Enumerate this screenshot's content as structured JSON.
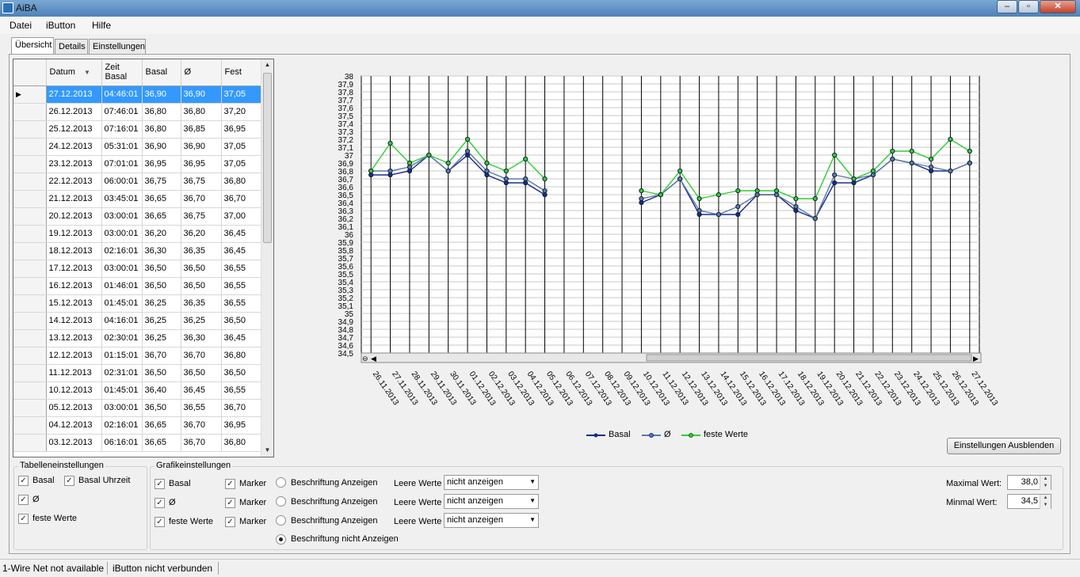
{
  "window": {
    "title": "AiBA"
  },
  "menu": [
    "Datei",
    "iButton",
    "Hilfe"
  ],
  "tabs": [
    "Übersicht",
    "Details",
    "Einstellungen"
  ],
  "table": {
    "columns": [
      "Datum",
      "Zeit Basal",
      "Basal",
      "Ø",
      "Fest"
    ],
    "rows": [
      [
        "27.12.2013",
        "04:46:01",
        "36,90",
        "36,90",
        "37,05"
      ],
      [
        "26.12.2013",
        "07:46:01",
        "36,80",
        "36,80",
        "37,20"
      ],
      [
        "25.12.2013",
        "07:16:01",
        "36,80",
        "36,85",
        "36,95"
      ],
      [
        "24.12.2013",
        "05:31:01",
        "36,90",
        "36,90",
        "37,05"
      ],
      [
        "23.12.2013",
        "07:01:01",
        "36,95",
        "36,95",
        "37,05"
      ],
      [
        "22.12.2013",
        "06:00:01",
        "36,75",
        "36,75",
        "36,80"
      ],
      [
        "21.12.2013",
        "03:45:01",
        "36,65",
        "36,70",
        "36,70"
      ],
      [
        "20.12.2013",
        "03:00:01",
        "36,65",
        "36,75",
        "37,00"
      ],
      [
        "19.12.2013",
        "03:00:01",
        "36,20",
        "36,20",
        "36,45"
      ],
      [
        "18.12.2013",
        "02:16:01",
        "36,30",
        "36,35",
        "36,45"
      ],
      [
        "17.12.2013",
        "03:00:01",
        "36,50",
        "36,50",
        "36,55"
      ],
      [
        "16.12.2013",
        "01:46:01",
        "36,50",
        "36,50",
        "36,55"
      ],
      [
        "15.12.2013",
        "01:45:01",
        "36,25",
        "36,35",
        "36,55"
      ],
      [
        "14.12.2013",
        "04:16:01",
        "36,25",
        "36,25",
        "36,50"
      ],
      [
        "13.12.2013",
        "02:30:01",
        "36,25",
        "36,30",
        "36,45"
      ],
      [
        "12.12.2013",
        "01:15:01",
        "36,70",
        "36,70",
        "36,80"
      ],
      [
        "11.12.2013",
        "02:31:01",
        "36,50",
        "36,50",
        "36,50"
      ],
      [
        "10.12.2013",
        "01:45:01",
        "36,40",
        "36,45",
        "36,55"
      ],
      [
        "05.12.2013",
        "03:00:01",
        "36,50",
        "36,55",
        "36,70"
      ],
      [
        "04.12.2013",
        "02:16:01",
        "36,65",
        "36,70",
        "36,95"
      ],
      [
        "03.12.2013",
        "06:16:01",
        "36,65",
        "36,70",
        "36,80"
      ]
    ]
  },
  "chart_data": {
    "type": "line",
    "ylim": [
      34.5,
      38
    ],
    "yticks": [
      "34,5",
      "34,6",
      "34,7",
      "34,8",
      "34,9",
      "35",
      "35,1",
      "35,2",
      "35,3",
      "35,4",
      "35,5",
      "35,6",
      "35,7",
      "35,8",
      "35,9",
      "36",
      "36,1",
      "36,2",
      "36,3",
      "36,4",
      "36,5",
      "36,6",
      "36,7",
      "36,8",
      "36,9",
      "37",
      "37,1",
      "37,2",
      "37,3",
      "37,4",
      "37,5",
      "37,6",
      "37,7",
      "37,8",
      "37,9",
      "38"
    ],
    "categories": [
      "26.11.2013",
      "27.11.2013",
      "28.11.2013",
      "29.11.2013",
      "30.11.2013",
      "01.12.2013",
      "02.12.2013",
      "03.12.2013",
      "04.12.2013",
      "05.12.2013",
      "06.12.2013",
      "07.12.2013",
      "08.12.2013",
      "09.12.2013",
      "10.12.2013",
      "11.12.2013",
      "12.12.2013",
      "13.12.2013",
      "14.12.2013",
      "15.12.2013",
      "16.12.2013",
      "17.12.2013",
      "18.12.2013",
      "19.12.2013",
      "20.12.2013",
      "21.12.2013",
      "22.12.2013",
      "23.12.2013",
      "24.12.2013",
      "25.12.2013",
      "26.12.2013",
      "27.12.2013"
    ],
    "series": [
      {
        "name": "Basal",
        "color": "#1a2a8c",
        "values": [
          36.75,
          36.75,
          36.8,
          37.0,
          36.8,
          37.0,
          36.75,
          36.65,
          36.65,
          36.5,
          null,
          null,
          null,
          null,
          36.4,
          36.5,
          36.7,
          36.25,
          36.25,
          36.25,
          36.5,
          36.5,
          36.3,
          36.2,
          36.65,
          36.65,
          36.75,
          36.95,
          36.9,
          36.8,
          36.8,
          36.9
        ]
      },
      {
        "name": "Ø",
        "color": "#5a7aa8",
        "values": [
          36.8,
          36.8,
          36.85,
          37.0,
          36.8,
          37.05,
          36.8,
          36.7,
          36.7,
          36.55,
          null,
          null,
          null,
          null,
          36.45,
          36.5,
          36.7,
          36.3,
          36.25,
          36.35,
          36.5,
          36.5,
          36.35,
          36.2,
          36.75,
          36.7,
          36.75,
          36.95,
          36.9,
          36.85,
          36.8,
          36.9
        ]
      },
      {
        "name": "feste Werte",
        "color": "#33cc33",
        "values": [
          36.8,
          37.15,
          36.9,
          37.0,
          36.9,
          37.2,
          36.9,
          36.8,
          36.95,
          36.7,
          null,
          null,
          null,
          null,
          36.55,
          36.5,
          36.8,
          36.45,
          36.5,
          36.55,
          36.55,
          36.55,
          36.45,
          36.45,
          37.0,
          36.7,
          36.8,
          37.05,
          37.05,
          36.95,
          37.2,
          37.05
        ]
      }
    ]
  },
  "buttons": {
    "hide_settings": "Einstellungen Ausblenden"
  },
  "table_settings": {
    "title": "Tabelleneinstellungen",
    "basal": "Basal",
    "basal_time": "Basal Uhrzeit",
    "avg": "Ø",
    "fixed": "feste Werte"
  },
  "graph_settings": {
    "title": "Grafikeinstellungen",
    "rows": [
      {
        "label": "Basal",
        "marker": "Marker",
        "radio": "Beschriftung Anzeigen",
        "empty": "Leere Werte",
        "select": "nicht anzeigen"
      },
      {
        "label": "Ø",
        "marker": "Marker",
        "radio": "Beschriftung Anzeigen",
        "empty": "Leere Werte",
        "select": "nicht anzeigen"
      },
      {
        "label": "feste Werte",
        "marker": "Marker",
        "radio": "Beschriftung Anzeigen",
        "empty": "Leere Werte",
        "select": "nicht anzeigen"
      }
    ],
    "radio_none": "Beschriftung nicht Anzeigen"
  },
  "limits": {
    "max_label": "Maximal Wert:",
    "max_value": "38,0",
    "min_label": "Minmal Wert:",
    "min_value": "34,5"
  },
  "status": {
    "wire": "1-Wire Net not available",
    "ibutton": "iButton nicht verbunden"
  }
}
